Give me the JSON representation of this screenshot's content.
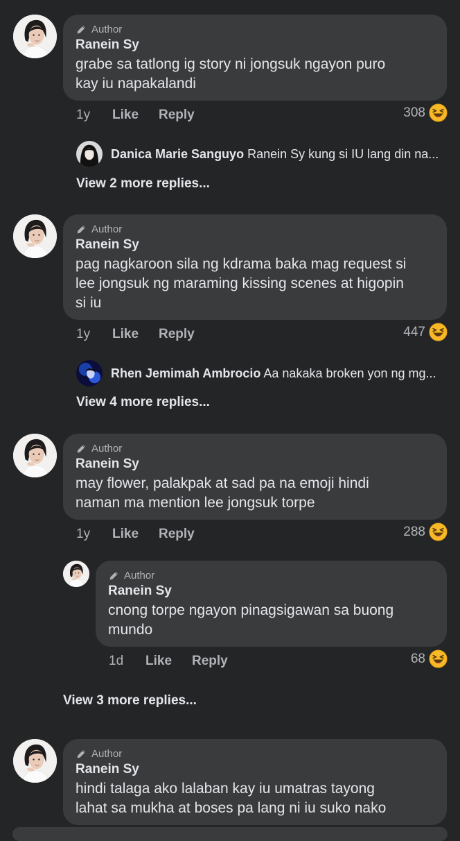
{
  "labels": {
    "author": "Author",
    "like": "Like",
    "reply": "Reply"
  },
  "colors": {
    "background": "#242526",
    "bubble": "#3a3b3c",
    "text": "#e4e6eb",
    "secondary": "#b0b3b8"
  },
  "icons": {
    "author_badge": "pencil-icon",
    "reaction": "laughing-emoji-icon"
  },
  "comments": [
    {
      "author": "Ranein Sy",
      "text_line1": "grabe sa tatlong ig story ni jongsuk ngayon puro",
      "text_line2": "kay iu napakalandi",
      "time": "1y",
      "reactions": "308",
      "reply_preview_name": "Danica Marie Sanguyo",
      "reply_preview_text": "Ranein Sy kung si IU lang din na...",
      "view_more": "View 2 more replies..."
    },
    {
      "author": "Ranein Sy",
      "text_line1": "pag nagkaroon sila ng kdrama baka mag request si",
      "text_line2": "lee jongsuk ng maraming kissing scenes at higopin",
      "text_line3": "si iu",
      "time": "1y",
      "reactions": "447",
      "reply_preview_name": "Rhen Jemimah Ambrocio",
      "reply_preview_text": "Aa nakaka broken yon ng mg...",
      "view_more": "View 4 more replies..."
    },
    {
      "author": "Ranein Sy",
      "text_line1": "may flower, palakpak at sad pa na emoji hindi",
      "text_line2": "naman ma mention lee jongsuk torpe",
      "time": "1y",
      "reactions": "288",
      "reply": {
        "author": "Ranein Sy",
        "text_line1": "cnong torpe ngayon pinagsigawan sa buong",
        "text_line2": "mundo",
        "time": "1d",
        "reactions": "68"
      },
      "view_more": "View 3 more replies..."
    },
    {
      "author": "Ranein Sy",
      "text_line1": "hindi talaga ako lalaban kay iu umatras tayong",
      "text_line2": "lahat sa mukha at boses pa lang ni iu suko nako"
    }
  ]
}
